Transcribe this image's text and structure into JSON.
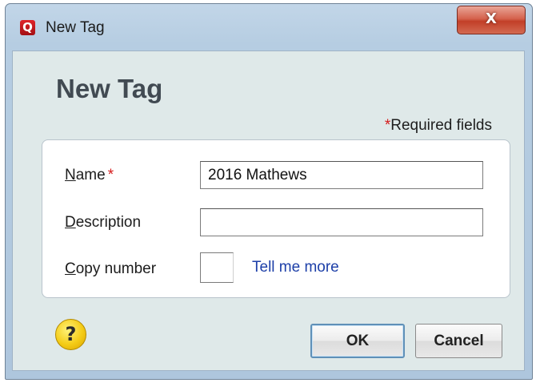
{
  "window": {
    "app_icon_glyph": "Q",
    "title": "New Tag",
    "close_glyph": "X"
  },
  "dialog": {
    "heading": "New Tag",
    "required_note": {
      "star": "*",
      "text": "Required fields"
    }
  },
  "form": {
    "name": {
      "label_underlined": "N",
      "label_rest": "ame",
      "required_star": "*",
      "value": "2016 Mathews",
      "placeholder": ""
    },
    "description": {
      "label_underlined": "D",
      "label_rest": "escription",
      "value": "",
      "placeholder": ""
    },
    "copy_number": {
      "label_underlined": "C",
      "label_rest": "opy number",
      "value": ""
    },
    "tell_me_more": "Tell me more"
  },
  "footer": {
    "help_glyph": "?",
    "ok_label": "OK",
    "cancel_label": "Cancel"
  },
  "colors": {
    "titlebar": "#b6cde2",
    "client_background": "#dfe9e9",
    "close_button": "#c94a32",
    "required_star": "#d51b1b",
    "link": "#1d3fa8",
    "help_icon": "#f4cc17",
    "default_button_border": "#5f90b8"
  },
  "icons": {
    "app": "quicken-q-icon",
    "close": "close-icon",
    "help": "help-question-icon"
  }
}
